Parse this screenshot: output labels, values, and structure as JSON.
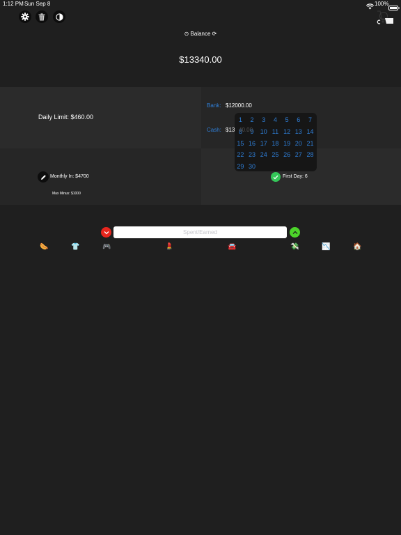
{
  "status_bar": {
    "time": "1:12 PM",
    "date": "Sun Sep 8",
    "battery": "100%"
  },
  "toolbar": {
    "settings_icon": "gear-icon",
    "delete_icon": "trash-icon",
    "theme_icon": "contrast-icon",
    "cart_icon": "shopping-cart-icon"
  },
  "header": {
    "balance_label": "⊙ Balance ⟳",
    "balance_value": "$13340.00"
  },
  "summary": {
    "daily_limit": "Daily Limit: $460.00",
    "bank_label": "Bank:",
    "bank_value": "$12000.00",
    "cash_label": "Cash:",
    "cash_value_visible": "$13",
    "cash_value_behind": "40.00",
    "monthly_in": "Monthly In: $4700",
    "max_minus": "Max Minus: $1000",
    "first_day": "First Day: 6"
  },
  "calendar": {
    "days": [
      "1",
      "2",
      "3",
      "4",
      "5",
      "6",
      "7",
      "8",
      "9",
      "10",
      "11",
      "12",
      "13",
      "14",
      "15",
      "16",
      "17",
      "18",
      "19",
      "20",
      "21",
      "22",
      "23",
      "24",
      "25",
      "26",
      "27",
      "28",
      "29",
      "30"
    ]
  },
  "entry": {
    "placeholder": "Spent/Earned",
    "spent_color": "#e8261e",
    "earned_color": "#4cd42a"
  },
  "categories": [
    {
      "icon": "food-icon",
      "glyph": "🌭"
    },
    {
      "icon": "clothing-icon",
      "glyph": "👕"
    },
    {
      "icon": "games-icon",
      "glyph": "🎮"
    },
    {
      "icon": "beauty-icon",
      "glyph": "💄"
    },
    {
      "icon": "car-icon",
      "glyph": "🚘"
    },
    {
      "icon": "money-icon",
      "glyph": "💸"
    },
    {
      "icon": "chart-icon",
      "glyph": "📉"
    },
    {
      "icon": "house-icon",
      "glyph": "🏠"
    }
  ]
}
